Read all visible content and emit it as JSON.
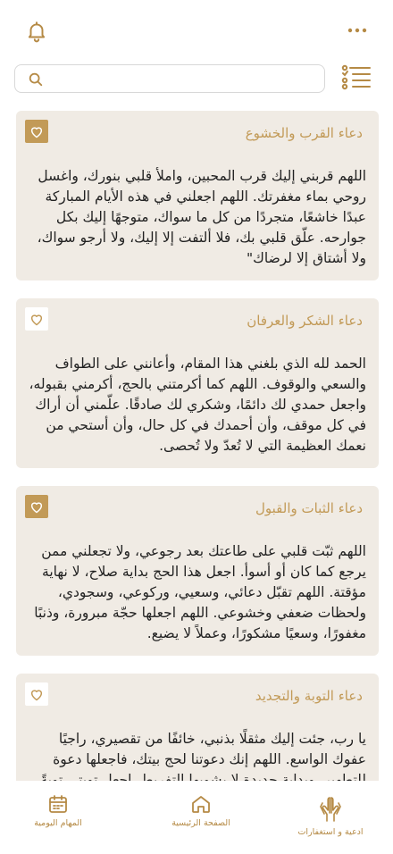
{
  "search": {
    "placeholder": ""
  },
  "cards": [
    {
      "title": "دعاء القرب والخشوع",
      "favorite": true,
      "text": "اللهم قربني إليك قرب المحبين، واملأ قلبي بنورك، واغسل روحي بماء مغفرتك. اللهم اجعلني في هذه الأيام المباركة عبدًا خاشعًا، متجردًا من كل ما سواك، متوجهًا إليك بكل جوارحه. علّق قلبي بك، فلا ألتفت إلا إليك، ولا أرجو سواك، ولا أشتاق إلا لرضاك\""
    },
    {
      "title": "دعاء الشكر والعرفان",
      "favorite": false,
      "text": "الحمد لله الذي بلغني هذا المقام، وأعانني على الطواف والسعي والوقوف. اللهم كما أكرمتني بالحج، أكرمني بقبوله، واجعل حمدي لك دائمًا، وشكري لك صادقًا. علّمني أن أراك في كل موقف، وأن أحمدك في كل حال، وأن أستحي من نعمك العظيمة التي لا تُعدّ ولا تُحصى."
    },
    {
      "title": "دعاء الثبات والقبول",
      "favorite": true,
      "text": "اللهم ثبّت قلبي على طاعتك بعد رجوعي، ولا تجعلني ممن يرجع كما كان أو أسوأ. اجعل هذا الحج بداية صلاح، لا نهاية مؤقتة. اللهم تقبّل دعائي، وسعيي، وركوعي، وسجودي، ولحظات ضعفي وخشوعي. اللهم اجعلها حجّة مبرورة، وذنبًا مغفورًا، وسعيًا مشكورًا، وعملاً لا يضيع."
    },
    {
      "title": "دعاء التوبة والتجديد",
      "favorite": false,
      "text": "يا رب، جئت إليك مثقلًا بذنبي، خائفًا من تقصيري، راجيًا عفوك الواسع. اللهم إنك دعوتنا لحج بيتك، فاجعلها دعوة للتطهير، وبداية جديدة لا يشوبها التفريط. اجعل توبتي توبةً نصوحًا."
    }
  ],
  "nav": {
    "daily_tasks": "المهام اليومية",
    "home": "الصفحة الرئيسية",
    "duas": "ادعية و استغفارات"
  },
  "colors": {
    "accent": "#c29a57",
    "card_bg": "#f0ebe4"
  },
  "icons": [
    "bell-icon",
    "more-dots-icon",
    "search-icon",
    "list-icon",
    "heart-icon",
    "calendar-icon",
    "home-icon",
    "praying-hands-icon"
  ]
}
